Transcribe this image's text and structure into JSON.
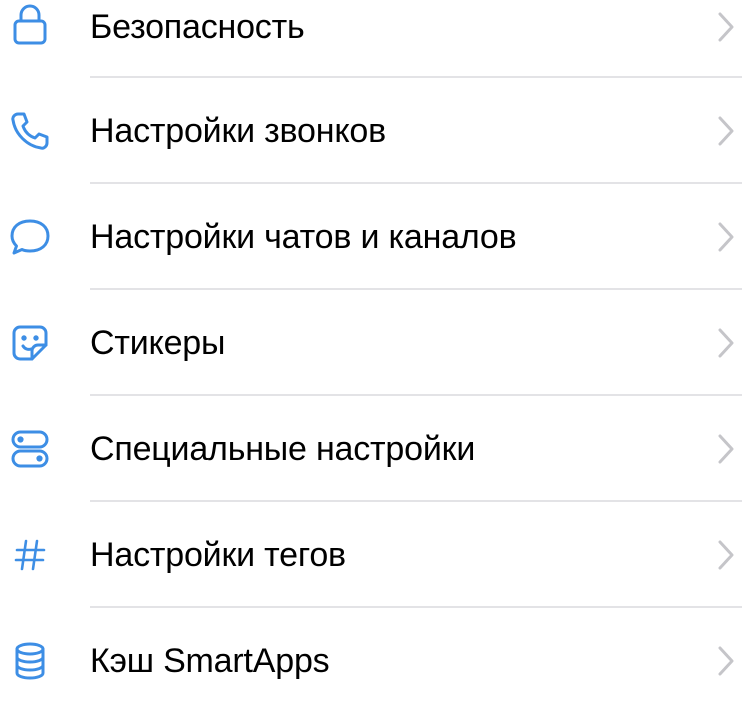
{
  "colors": {
    "accent": "#3d8ee5",
    "chevron": "#c5c5c9",
    "divider": "#e3e3e6",
    "text": "#000000"
  },
  "settings": {
    "items": [
      {
        "label": "Безопасность",
        "icon": "lock-icon"
      },
      {
        "label": "Настройки звонков",
        "icon": "phone-icon"
      },
      {
        "label": "Настройки чатов и каналов",
        "icon": "chat-bubble-icon"
      },
      {
        "label": "Стикеры",
        "icon": "sticker-icon"
      },
      {
        "label": "Специальные настройки",
        "icon": "toggles-icon"
      },
      {
        "label": "Настройки тегов",
        "icon": "hashtag-icon"
      },
      {
        "label": "Кэш SmartApps",
        "icon": "database-icon"
      }
    ]
  }
}
